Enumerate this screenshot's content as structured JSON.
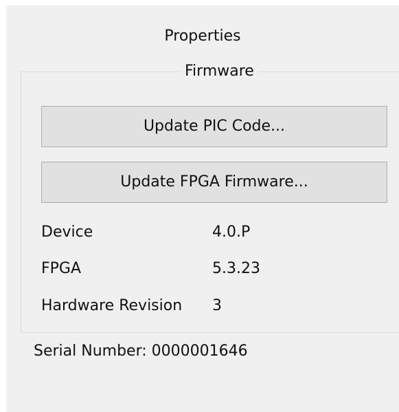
{
  "panel": {
    "title": "Properties"
  },
  "firmware": {
    "group_label": "Firmware",
    "update_pic_label": "Update PIC Code...",
    "update_fpga_label": "Update FPGA Firmware..."
  },
  "info": {
    "device_label": "Device",
    "device_value": "4.0.P",
    "fpga_label": "FPGA",
    "fpga_value": "5.3.23",
    "hw_label": "Hardware Revision",
    "hw_value": "3"
  },
  "serial": {
    "label": "Serial Number: 0000001646"
  }
}
